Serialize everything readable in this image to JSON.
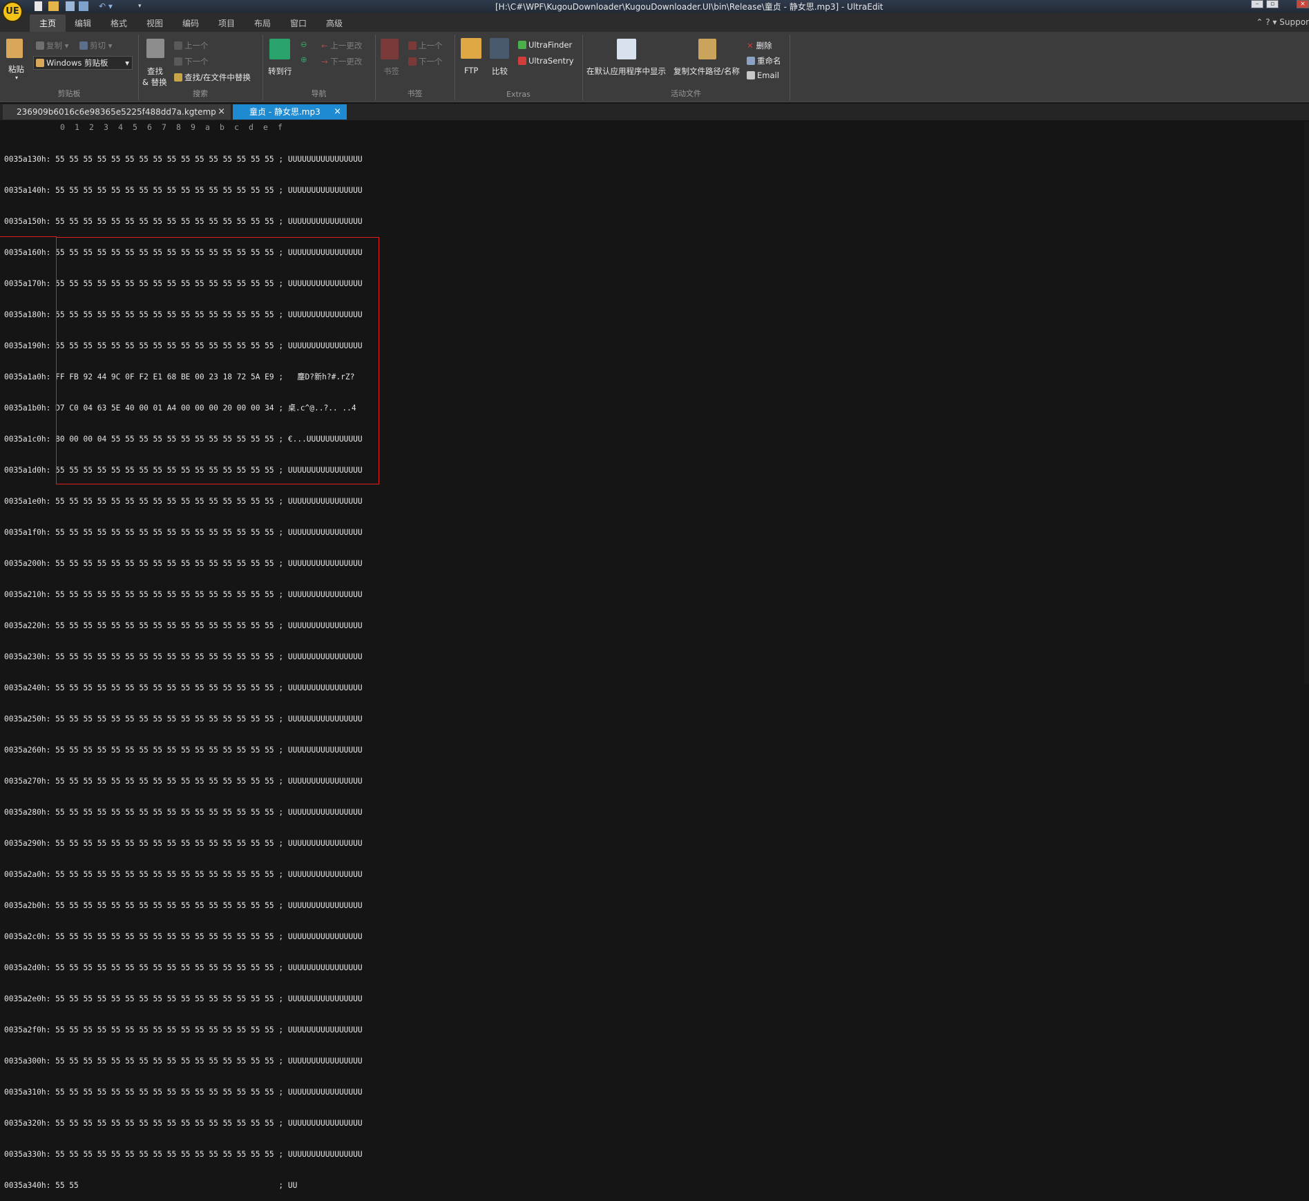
{
  "window": {
    "title": "[H:\\C#\\WPF\\KugouDownloader\\KugouDownloader.UI\\bin\\Release\\童贞 - 静女思.mp3] - UltraEdit",
    "logo_text": "UE",
    "support_label": "Suppor"
  },
  "menu": [
    "主页",
    "编辑",
    "格式",
    "视图",
    "编码",
    "项目",
    "布局",
    "窗口",
    "高级"
  ],
  "ribbon": {
    "clipboard": {
      "paste": "粘贴",
      "copy": "复制",
      "cut": "剪切",
      "windows_clipboard": "Windows 剪贴板",
      "label": "剪贴板"
    },
    "search": {
      "find": "查找",
      "replace": "& 替换",
      "prev": "上一个",
      "next": "下一个",
      "find_in_files": "查找/在文件中替换",
      "label": "搜索"
    },
    "navigation": {
      "goto": "转到行",
      "prev_change": "上一更改",
      "next_change": "下一更改",
      "label": "导航"
    },
    "bookmarks": {
      "bookmark": "书签",
      "prev": "上一个",
      "next": "下一个",
      "label": "书签"
    },
    "extras": {
      "ftp": "FTP",
      "compare": "比较",
      "ultrafinder": "UltraFinder",
      "ultrasentry": "UltraSentry",
      "label": "Extras"
    },
    "active_file": {
      "show_default": "在默认应用程序中显示",
      "copy_path": "复制文件路径/名称",
      "delete": "删除",
      "rename": "重命名",
      "email": "Email",
      "label": "活动文件"
    }
  },
  "tabs": [
    {
      "label": "236909b6016c6e98365e5225f488dd7a.kgtemp",
      "close": "×"
    },
    {
      "label": "童贞 - 静女思.mp3",
      "close": "×"
    }
  ],
  "ruler": [
    "0",
    "1",
    "2",
    "3",
    "4",
    "5",
    "6",
    "7",
    "8",
    "9",
    "a",
    "b",
    "c",
    "d",
    "e",
    "f"
  ],
  "hex_rows": [
    "0035a130h: 55 55 55 55 55 55 55 55 55 55 55 55 55 55 55 55 ; UUUUUUUUUUUUUUUU",
    "0035a140h: 55 55 55 55 55 55 55 55 55 55 55 55 55 55 55 55 ; UUUUUUUUUUUUUUUU",
    "0035a150h: 55 55 55 55 55 55 55 55 55 55 55 55 55 55 55 55 ; UUUUUUUUUUUUUUUU",
    "0035a160h: 55 55 55 55 55 55 55 55 55 55 55 55 55 55 55 55 ; UUUUUUUUUUUUUUUU",
    "0035a170h: 55 55 55 55 55 55 55 55 55 55 55 55 55 55 55 55 ; UUUUUUUUUUUUUUUU",
    "0035a180h: 55 55 55 55 55 55 55 55 55 55 55 55 55 55 55 55 ; UUUUUUUUUUUUUUUU",
    "0035a190h: 55 55 55 55 55 55 55 55 55 55 55 55 55 55 55 55 ; UUUUUUUUUUUUUUUU",
    "0035a1a0h: FF FB 92 44 9C 0F F2 E1 68 BE 00 23 18 72 5A E9 ;   鏖D?新h?#.rZ?",
    "0035a1b0h: D7 C0 04 63 5E 40 00 01 A4 00 00 00 20 00 00 34 ; 桌.c^@..?.. ..4",
    "0035a1c0h: 80 00 00 04 55 55 55 55 55 55 55 55 55 55 55 55 ; €...UUUUUUUUUUUU",
    "0035a1d0h: 55 55 55 55 55 55 55 55 55 55 55 55 55 55 55 55 ; UUUUUUUUUUUUUUUU",
    "0035a1e0h: 55 55 55 55 55 55 55 55 55 55 55 55 55 55 55 55 ; UUUUUUUUUUUUUUUU",
    "0035a1f0h: 55 55 55 55 55 55 55 55 55 55 55 55 55 55 55 55 ; UUUUUUUUUUUUUUUU",
    "0035a200h: 55 55 55 55 55 55 55 55 55 55 55 55 55 55 55 55 ; UUUUUUUUUUUUUUUU",
    "0035a210h: 55 55 55 55 55 55 55 55 55 55 55 55 55 55 55 55 ; UUUUUUUUUUUUUUUU",
    "0035a220h: 55 55 55 55 55 55 55 55 55 55 55 55 55 55 55 55 ; UUUUUUUUUUUUUUUU",
    "0035a230h: 55 55 55 55 55 55 55 55 55 55 55 55 55 55 55 55 ; UUUUUUUUUUUUUUUU",
    "0035a240h: 55 55 55 55 55 55 55 55 55 55 55 55 55 55 55 55 ; UUUUUUUUUUUUUUUU",
    "0035a250h: 55 55 55 55 55 55 55 55 55 55 55 55 55 55 55 55 ; UUUUUUUUUUUUUUUU",
    "0035a260h: 55 55 55 55 55 55 55 55 55 55 55 55 55 55 55 55 ; UUUUUUUUUUUUUUUU",
    "0035a270h: 55 55 55 55 55 55 55 55 55 55 55 55 55 55 55 55 ; UUUUUUUUUUUUUUUU",
    "0035a280h: 55 55 55 55 55 55 55 55 55 55 55 55 55 55 55 55 ; UUUUUUUUUUUUUUUU",
    "0035a290h: 55 55 55 55 55 55 55 55 55 55 55 55 55 55 55 55 ; UUUUUUUUUUUUUUUU",
    "0035a2a0h: 55 55 55 55 55 55 55 55 55 55 55 55 55 55 55 55 ; UUUUUUUUUUUUUUUU",
    "0035a2b0h: 55 55 55 55 55 55 55 55 55 55 55 55 55 55 55 55 ; UUUUUUUUUUUUUUUU",
    "0035a2c0h: 55 55 55 55 55 55 55 55 55 55 55 55 55 55 55 55 ; UUUUUUUUUUUUUUUU",
    "0035a2d0h: 55 55 55 55 55 55 55 55 55 55 55 55 55 55 55 55 ; UUUUUUUUUUUUUUUU",
    "0035a2e0h: 55 55 55 55 55 55 55 55 55 55 55 55 55 55 55 55 ; UUUUUUUUUUUUUUUU",
    "0035a2f0h: 55 55 55 55 55 55 55 55 55 55 55 55 55 55 55 55 ; UUUUUUUUUUUUUUUU",
    "0035a300h: 55 55 55 55 55 55 55 55 55 55 55 55 55 55 55 55 ; UUUUUUUUUUUUUUUU",
    "0035a310h: 55 55 55 55 55 55 55 55 55 55 55 55 55 55 55 55 ; UUUUUUUUUUUUUUUU",
    "0035a320h: 55 55 55 55 55 55 55 55 55 55 55 55 55 55 55 55 ; UUUUUUUUUUUUUUUU",
    "0035a330h: 55 55 55 55 55 55 55 55 55 55 55 55 55 55 55 55 ; UUUUUUUUUUUUUUUU",
    "0035a340h: 55 55                                           ; UU"
  ],
  "colors": {
    "accent_tab": "#1e8ad2",
    "selection_border": "#e02020"
  }
}
